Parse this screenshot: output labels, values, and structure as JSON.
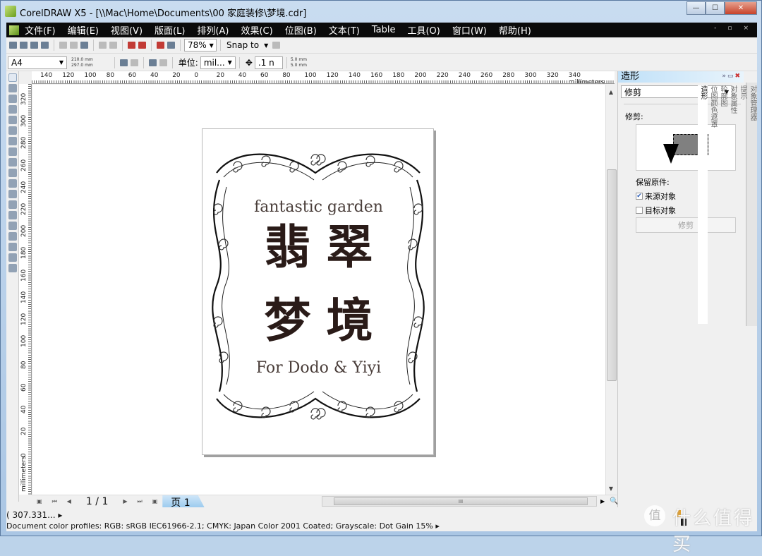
{
  "window": {
    "title": "CorelDRAW X5 - [\\\\Mac\\Home\\Documents\\00 家庭装修\\梦境.cdr]",
    "min_label": "—",
    "max_label": "☐",
    "close_label": "✕"
  },
  "menu": [
    "文件(F)",
    "编辑(E)",
    "视图(V)",
    "版面(L)",
    "排列(A)",
    "效果(C)",
    "位图(B)",
    "文本(T)",
    "Table",
    "工具(O)",
    "窗口(W)",
    "帮助(H)"
  ],
  "mdi_controls": [
    "-",
    "▫",
    "×"
  ],
  "toolbar": {
    "zoom": "78%",
    "snap_to": "Snap to",
    "page_size": "A4",
    "width": "210.0 mm",
    "height": "297.0 mm",
    "units_label": "单位:",
    "units_value": "mil...",
    "nudge": ".1 n",
    "dup_x": "5.0 mm",
    "dup_y": "5.0 mm"
  },
  "ruler": {
    "h_labels": [
      "140",
      "120",
      "100",
      "80",
      "60",
      "40",
      "20",
      "0",
      "20",
      "40",
      "60",
      "80",
      "100",
      "120",
      "140",
      "160",
      "180",
      "200",
      "220",
      "240",
      "260",
      "280",
      "300",
      "320",
      "340 millimeters"
    ],
    "v_labels": [
      "320",
      "300",
      "280",
      "260",
      "240",
      "220",
      "200",
      "180",
      "160",
      "140",
      "120",
      "100",
      "80",
      "60",
      "40",
      "20",
      "0"
    ],
    "v_unit": "millimeters"
  },
  "artwork": {
    "line1": "fantastic garden",
    "title1": "翡翠",
    "title2": "梦境",
    "line2": "For Dodo & Yiyi"
  },
  "page_nav": {
    "counter": "1 / 1",
    "tab": "页 1"
  },
  "docker": {
    "title": "造形",
    "mode": "修剪",
    "section_label": "修剪:",
    "keep_label": "保留原件:",
    "source_label": "来源对象",
    "source_checked": true,
    "target_label": "目标对象",
    "target_checked": false,
    "apply_label": "修剪",
    "side_tabs": [
      "对象管理器",
      "提示",
      "对象属性",
      "轮廓图",
      "位图颜色遮罩",
      "造形"
    ]
  },
  "status": {
    "coords": "( 307.331... ▸",
    "profiles": "Document color profiles: RGB: sRGB IEC61966-2.1; CMYK: Japan Color 2001 Coated; Grayscale: Dot Gain 15% ▸"
  },
  "watermark": {
    "badge": "值",
    "text": "什么值得买"
  }
}
